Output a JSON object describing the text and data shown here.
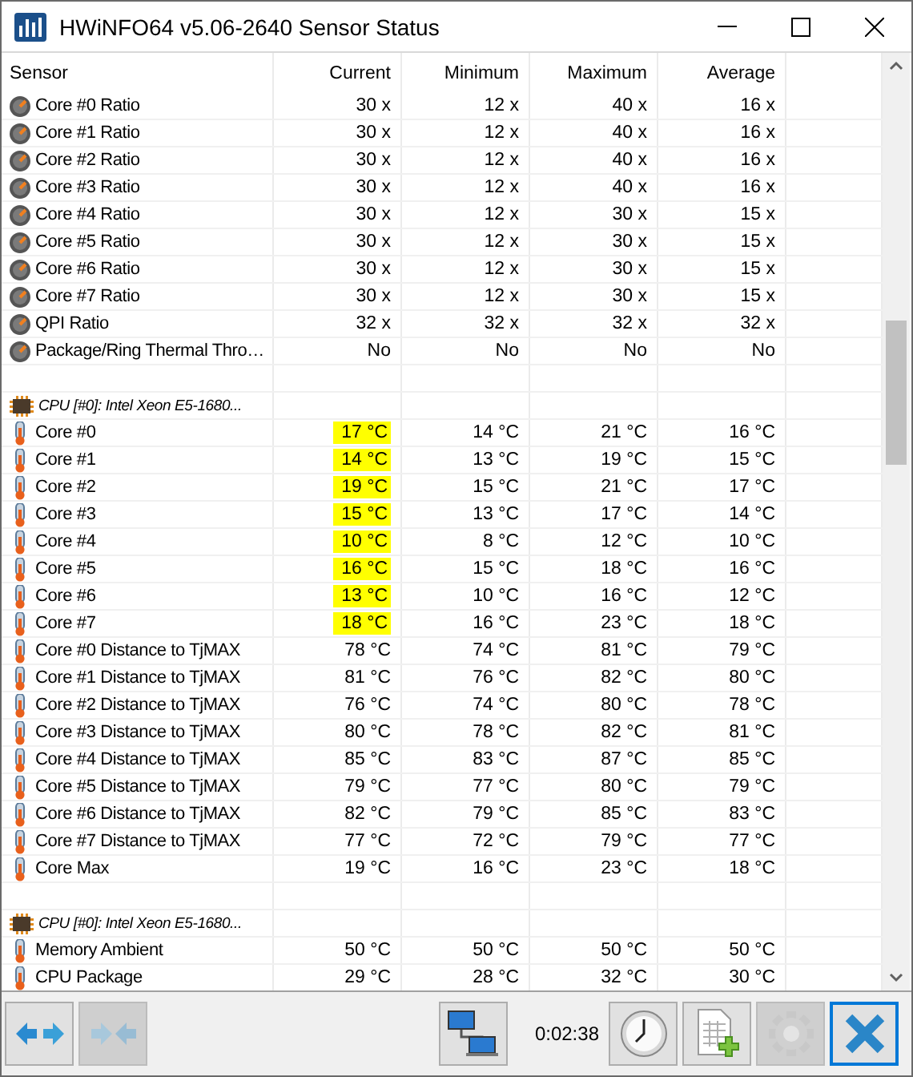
{
  "window": {
    "title": "HWiNFO64 v5.06-2640 Sensor Status"
  },
  "table": {
    "columns": [
      "Sensor",
      "Current",
      "Minimum",
      "Maximum",
      "Average"
    ],
    "rows": [
      {
        "kind": "gauge",
        "name": "Core #0 Ratio",
        "values": [
          "30 x",
          "12 x",
          "40 x",
          "16 x"
        ],
        "highlighted": false
      },
      {
        "kind": "gauge",
        "name": "Core #1 Ratio",
        "values": [
          "30 x",
          "12 x",
          "40 x",
          "16 x"
        ],
        "highlighted": false
      },
      {
        "kind": "gauge",
        "name": "Core #2 Ratio",
        "values": [
          "30 x",
          "12 x",
          "40 x",
          "16 x"
        ],
        "highlighted": false
      },
      {
        "kind": "gauge",
        "name": "Core #3 Ratio",
        "values": [
          "30 x",
          "12 x",
          "40 x",
          "16 x"
        ],
        "highlighted": false
      },
      {
        "kind": "gauge",
        "name": "Core #4 Ratio",
        "values": [
          "30 x",
          "12 x",
          "30 x",
          "15 x"
        ],
        "highlighted": false
      },
      {
        "kind": "gauge",
        "name": "Core #5 Ratio",
        "values": [
          "30 x",
          "12 x",
          "30 x",
          "15 x"
        ],
        "highlighted": false
      },
      {
        "kind": "gauge",
        "name": "Core #6 Ratio",
        "values": [
          "30 x",
          "12 x",
          "30 x",
          "15 x"
        ],
        "highlighted": false
      },
      {
        "kind": "gauge",
        "name": "Core #7 Ratio",
        "values": [
          "30 x",
          "12 x",
          "30 x",
          "15 x"
        ],
        "highlighted": false
      },
      {
        "kind": "gauge",
        "name": "QPI Ratio",
        "values": [
          "32 x",
          "32 x",
          "32 x",
          "32 x"
        ],
        "highlighted": false
      },
      {
        "kind": "gauge",
        "name": "Package/Ring Thermal Thro…",
        "values": [
          "No",
          "No",
          "No",
          "No"
        ],
        "highlighted": false
      },
      {
        "kind": "blank"
      },
      {
        "kind": "group",
        "name": "CPU [#0]: Intel Xeon E5-1680..."
      },
      {
        "kind": "thermometer",
        "name": "Core #0",
        "values": [
          "17 °C",
          "14 °C",
          "21 °C",
          "16 °C"
        ],
        "highlighted": true
      },
      {
        "kind": "thermometer",
        "name": "Core #1",
        "values": [
          "14 °C",
          "13 °C",
          "19 °C",
          "15 °C"
        ],
        "highlighted": true
      },
      {
        "kind": "thermometer",
        "name": "Core #2",
        "values": [
          "19 °C",
          "15 °C",
          "21 °C",
          "17 °C"
        ],
        "highlighted": true
      },
      {
        "kind": "thermometer",
        "name": "Core #3",
        "values": [
          "15 °C",
          "13 °C",
          "17 °C",
          "14 °C"
        ],
        "highlighted": true
      },
      {
        "kind": "thermometer",
        "name": "Core #4",
        "values": [
          "10 °C",
          "8 °C",
          "12 °C",
          "10 °C"
        ],
        "highlighted": true
      },
      {
        "kind": "thermometer",
        "name": "Core #5",
        "values": [
          "16 °C",
          "15 °C",
          "18 °C",
          "16 °C"
        ],
        "highlighted": true
      },
      {
        "kind": "thermometer",
        "name": "Core #6",
        "values": [
          "13 °C",
          "10 °C",
          "16 °C",
          "12 °C"
        ],
        "highlighted": true
      },
      {
        "kind": "thermometer",
        "name": "Core #7",
        "values": [
          "18 °C",
          "16 °C",
          "23 °C",
          "18 °C"
        ],
        "highlighted": true
      },
      {
        "kind": "thermometer",
        "name": "Core #0 Distance to TjMAX",
        "values": [
          "78 °C",
          "74 °C",
          "81 °C",
          "79 °C"
        ],
        "highlighted": false
      },
      {
        "kind": "thermometer",
        "name": "Core #1 Distance to TjMAX",
        "values": [
          "81 °C",
          "76 °C",
          "82 °C",
          "80 °C"
        ],
        "highlighted": false
      },
      {
        "kind": "thermometer",
        "name": "Core #2 Distance to TjMAX",
        "values": [
          "76 °C",
          "74 °C",
          "80 °C",
          "78 °C"
        ],
        "highlighted": false
      },
      {
        "kind": "thermometer",
        "name": "Core #3 Distance to TjMAX",
        "values": [
          "80 °C",
          "78 °C",
          "82 °C",
          "81 °C"
        ],
        "highlighted": false
      },
      {
        "kind": "thermometer",
        "name": "Core #4 Distance to TjMAX",
        "values": [
          "85 °C",
          "83 °C",
          "87 °C",
          "85 °C"
        ],
        "highlighted": false
      },
      {
        "kind": "thermometer",
        "name": "Core #5 Distance to TjMAX",
        "values": [
          "79 °C",
          "77 °C",
          "80 °C",
          "79 °C"
        ],
        "highlighted": false
      },
      {
        "kind": "thermometer",
        "name": "Core #6 Distance to TjMAX",
        "values": [
          "82 °C",
          "79 °C",
          "85 °C",
          "83 °C"
        ],
        "highlighted": false
      },
      {
        "kind": "thermometer",
        "name": "Core #7 Distance to TjMAX",
        "values": [
          "77 °C",
          "72 °C",
          "79 °C",
          "77 °C"
        ],
        "highlighted": false
      },
      {
        "kind": "thermometer",
        "name": "Core Max",
        "values": [
          "19 °C",
          "16 °C",
          "23 °C",
          "18 °C"
        ],
        "highlighted": false
      },
      {
        "kind": "blank"
      },
      {
        "kind": "group",
        "name": "CPU [#0]: Intel Xeon E5-1680..."
      },
      {
        "kind": "thermometer",
        "name": "Memory Ambient",
        "values": [
          "50 °C",
          "50 °C",
          "50 °C",
          "50 °C"
        ],
        "highlighted": false
      },
      {
        "kind": "thermometer",
        "name": "CPU Package",
        "values": [
          "29 °C",
          "28 °C",
          "32 °C",
          "30 °C"
        ],
        "highlighted": false
      }
    ]
  },
  "toolbar": {
    "left_buttons": [
      {
        "disabled": false,
        "focused": false
      },
      {
        "disabled": true,
        "focused": false
      }
    ],
    "network_button": {
      "disabled": false,
      "focused": false
    },
    "timer": "0:02:38",
    "right_buttons": [
      {
        "disabled": false,
        "focused": false
      },
      {
        "disabled": false,
        "focused": false
      },
      {
        "disabled": true,
        "focused": false
      },
      {
        "disabled": false,
        "focused": true
      }
    ]
  }
}
